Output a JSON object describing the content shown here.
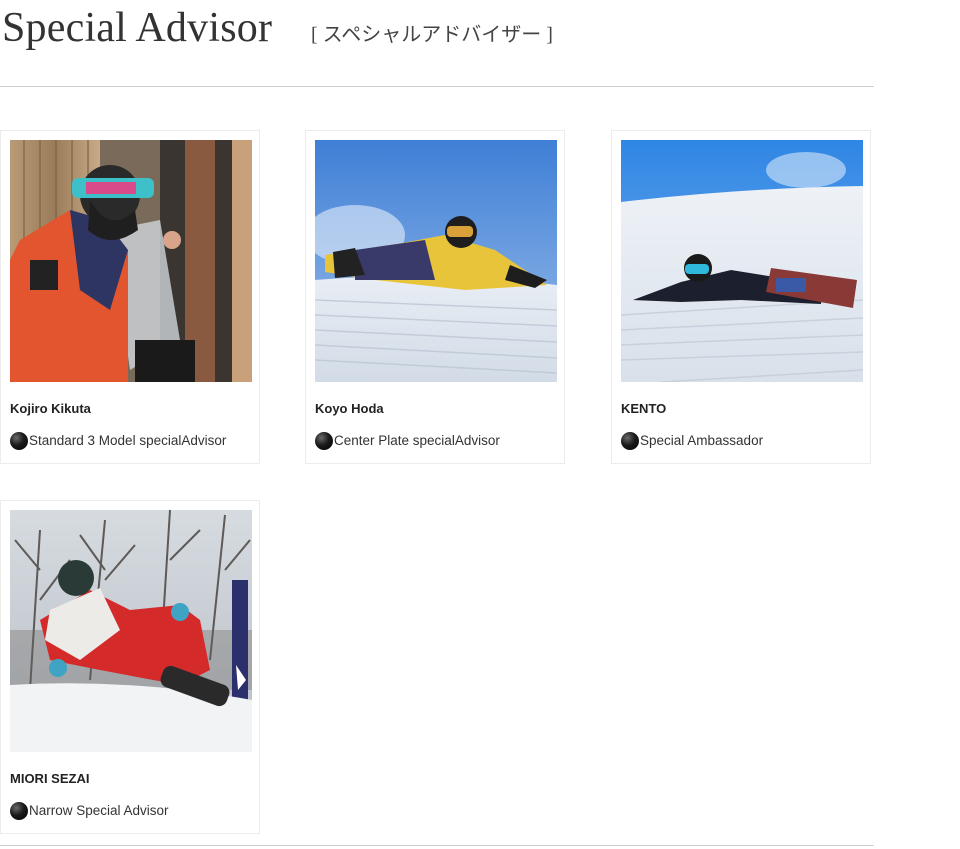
{
  "header": {
    "title": "Special Advisor",
    "subtitle": "[ スペシャルアドバイザー ]"
  },
  "advisors": [
    {
      "name": "Kojiro Kikuta",
      "role": "Standard 3 Model specialAdvisor",
      "photo_icon": "snowboarder-portrait-photo"
    },
    {
      "name": "Koyo Hoda",
      "role": "Center Plate specialAdvisor",
      "photo_icon": "snowboarder-carving-photo"
    },
    {
      "name": "KENTO",
      "role": "Special Ambassador",
      "photo_icon": "snowboarder-carving-photo"
    },
    {
      "name": "MIORI SEZAI",
      "role": "Narrow Special Advisor",
      "photo_icon": "snowboarder-racing-photo"
    }
  ],
  "colors": {
    "bullet": "#000000",
    "divider": "#cfcfcf",
    "card_border": "#ececec"
  }
}
